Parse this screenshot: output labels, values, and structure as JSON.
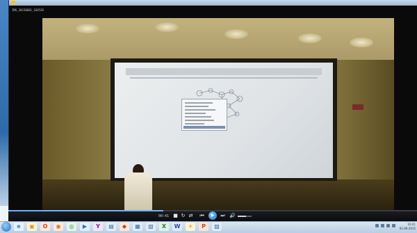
{
  "window": {
    "filename": "IMG_20150601_103528"
  },
  "playback": {
    "time": "00:41",
    "progress_fraction": 0.38,
    "volume_fraction": 0.6
  },
  "controls": [
    {
      "name": "stop-icon",
      "glyph": "■"
    },
    {
      "name": "repeat-icon",
      "glyph": "↻"
    },
    {
      "name": "shuffle-icon",
      "glyph": "⇄"
    },
    {
      "name": "previous-icon",
      "glyph": "⏮"
    },
    {
      "name": "play-icon",
      "glyph": "▶"
    },
    {
      "name": "next-icon",
      "glyph": "⏭"
    },
    {
      "name": "volume-icon",
      "glyph": "🔊"
    }
  ],
  "taskbar": {
    "apps": [
      {
        "name": "ie-icon",
        "label": "e",
        "color": "#2b7bd6",
        "bg": "#e7f1fb"
      },
      {
        "name": "folder-icon",
        "label": "▣",
        "color": "#d99a22",
        "bg": "#fff2d4"
      },
      {
        "name": "office-icon",
        "label": "O",
        "color": "#d8461b",
        "bg": "#fde6dd"
      },
      {
        "name": "firefox-icon",
        "label": "◉",
        "color": "#e8661c",
        "bg": "#fde9d8"
      },
      {
        "name": "chrome-icon",
        "label": "◎",
        "color": "#2a9a3a",
        "bg": "#e5f5e8"
      },
      {
        "name": "media-player-icon",
        "label": "▶",
        "color": "#1e6fc9",
        "bg": "#e3eefb"
      },
      {
        "name": "yahoo-icon",
        "label": "Y",
        "color": "#7a1fa2",
        "bg": "#f3e4fa"
      },
      {
        "name": "calendar-icon",
        "label": "▤",
        "color": "#2a6aa8",
        "bg": "#e3edf7"
      },
      {
        "name": "matlab-icon",
        "label": "◆",
        "color": "#c7461a",
        "bg": "#fbe6dc"
      },
      {
        "name": "photos-icon",
        "label": "▦",
        "color": "#2f6fae",
        "bg": "#e2ecf6"
      },
      {
        "name": "network-icon",
        "label": "▧",
        "color": "#2f6fae",
        "bg": "#e2ecf6"
      },
      {
        "name": "excel-icon",
        "label": "X",
        "color": "#1e7a3c",
        "bg": "#e1f2e6"
      },
      {
        "name": "word-icon",
        "label": "W",
        "color": "#1f4fa0",
        "bg": "#e1e9f7"
      },
      {
        "name": "weather-icon",
        "label": "☀",
        "color": "#e0a018",
        "bg": "#fdf3d8"
      },
      {
        "name": "powerpoint-icon",
        "label": "P",
        "color": "#c8431b",
        "bg": "#fbe4da"
      },
      {
        "name": "gallery-icon",
        "label": "▨",
        "color": "#2f6fae",
        "bg": "#e2ecf6"
      }
    ],
    "clock_time": "10:41",
    "clock_date": "01-06-2015"
  }
}
